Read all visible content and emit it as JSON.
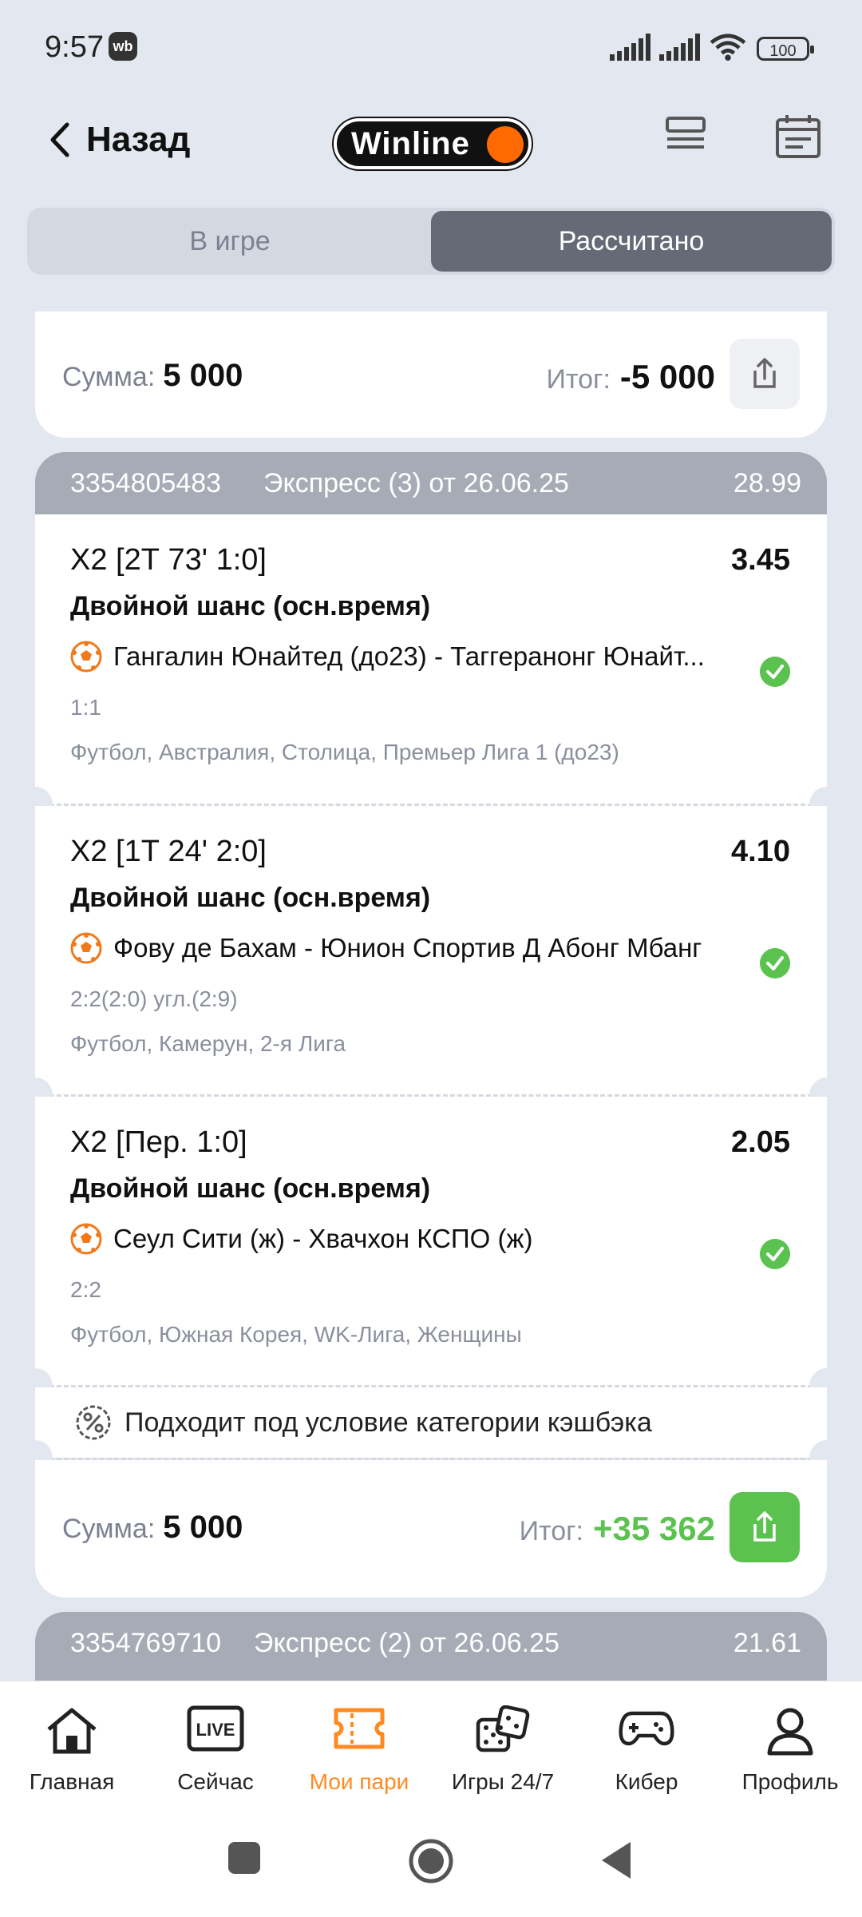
{
  "status_bar": {
    "time": "9:57",
    "badge": "wb",
    "battery": "100"
  },
  "header": {
    "back_label": "Назад",
    "logo_text": "Winline"
  },
  "tabs": {
    "inactive": "В игре",
    "active": "Рассчитано"
  },
  "bet1": {
    "sum_label": "Сумма:",
    "sum_value": "5 000",
    "result_label": "Итог:",
    "result_value": "-5 000"
  },
  "bet2": {
    "id": "3354805483",
    "type": "Экспресс (3)  от 26.06.25",
    "total_odd": "28.99",
    "legs": [
      {
        "title": "X2 [2Т 73' 1:0]",
        "odd": "3.45",
        "market": "Двойной шанс (осн.время)",
        "match": "Гангалин Юнайтед (до23) - Таггеранонг Юнайт...",
        "score": "1:1",
        "league": "Футбол, Австралия, Столица, Премьер Лига 1 (до23)"
      },
      {
        "title": "X2 [1Т 24' 2:0]",
        "odd": "4.10",
        "market": "Двойной шанс (осн.время)",
        "match": "Фову де Бахам - Юнион Спортив Д Абонг Мбанг",
        "score": "2:2(2:0) угл.(2:9)",
        "league": "Футбол, Камерун, 2-я Лига"
      },
      {
        "title": "X2 [Пер. 1:0]",
        "odd": "2.05",
        "market": "Двойной шанс (осн.время)",
        "match": "Сеул Сити (ж) - Хвачхон КСПО (ж)",
        "score": "2:2",
        "league": "Футбол, Южная Корея, WK-Лига, Женщины"
      }
    ],
    "cashback": "Подходит под условие категории кэшбэка",
    "sum_label": "Сумма:",
    "sum_value": "5 000",
    "result_label": "Итог:",
    "result_value": "+35 362",
    "win_color": "#5bc24f"
  },
  "bet3": {
    "id": "3354769710",
    "type": "Экспресс (2)  от 26.06.25",
    "total_odd": "21.61"
  },
  "nav": {
    "items": [
      {
        "label": "Главная",
        "icon": "home-icon"
      },
      {
        "label": "Сейчас",
        "icon": "live-icon",
        "badge": "LIVE"
      },
      {
        "label": "Мои пари",
        "icon": "ticket-icon"
      },
      {
        "label": "Игры 24/7",
        "icon": "dice-icon"
      },
      {
        "label": "Кибер",
        "icon": "gamepad-icon"
      },
      {
        "label": "Профиль",
        "icon": "profile-icon"
      }
    ],
    "active_color": "#ff8a1f"
  }
}
